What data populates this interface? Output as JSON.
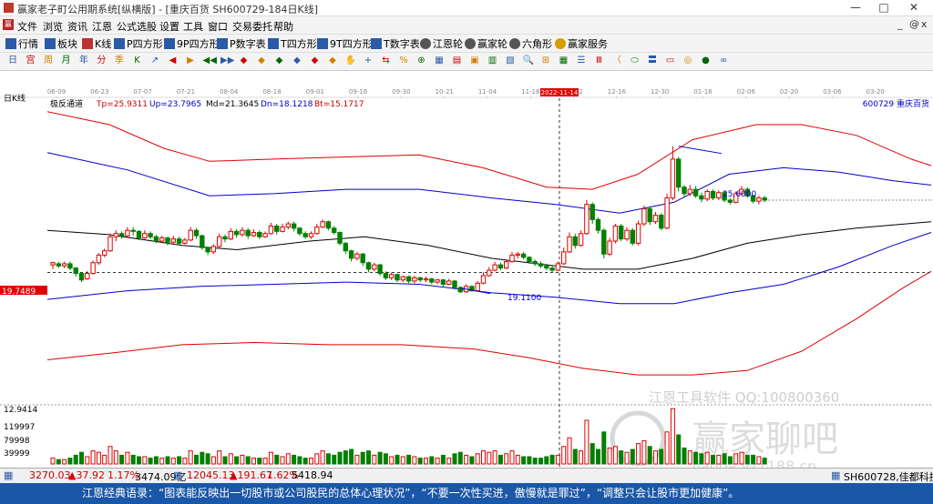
{
  "window": {
    "title": "赢家老子町公用期系统[纵横版] - [重庆百货  SH600729-184日K线]",
    "controls": [
      "—",
      "□",
      "✕"
    ]
  },
  "menu": {
    "items": [
      "文件",
      "浏览",
      "资讯",
      "江恩",
      "公式选股",
      "设置",
      "工具",
      "窗口",
      "交易委托",
      "帮助"
    ],
    "right_controls": [
      "_",
      "@",
      "x"
    ]
  },
  "toolbar1": {
    "buttons": [
      "行情",
      "板块",
      "K线",
      "P四方形",
      "9P四方形",
      "P数字表",
      "T四方形",
      "9T四方形",
      "T数字表",
      "江恩轮",
      "赢家轮",
      "六角形",
      "赢家服务"
    ]
  },
  "toolbar2": {
    "icons": [
      "日",
      "宫",
      "周",
      "月",
      "年",
      "分",
      "季",
      "K",
      "↗",
      "◀",
      "▶",
      "◀◀",
      "▶▶",
      "◆",
      "◆",
      "◆",
      "◆",
      "◆",
      "◆",
      "✋",
      "+",
      "⇆",
      "%",
      "⊕",
      "▦",
      "▤",
      "▣",
      "▥",
      "▧",
      "🔍",
      "⊞",
      "▦",
      "☰",
      "Ⅲ",
      "〈",
      "⬭",
      "〓",
      "▭",
      "◎",
      "●",
      "∞"
    ]
  },
  "chart_header": {
    "period_label": "日K线",
    "indicator": "极反通道",
    "tp": "Tp=25.9311",
    "up": "Up=23.7965",
    "md": "Md=21.3645",
    "dn": "Dn=18.1218",
    "bt": "Bt=15.1717",
    "stock": "600729  重庆百货"
  },
  "time_axis": {
    "labels": [
      "06-09",
      "06-23",
      "07-07",
      "07-21",
      "08-04",
      "08-18",
      "09-01",
      "09-16",
      "09-30",
      "10-21",
      "11-04",
      "11-18",
      "12-02",
      "12-16",
      "12-30",
      "01-16",
      "02-06",
      "02-20",
      "03-06",
      "03-20"
    ],
    "highlight": "2022-11-14"
  },
  "price_labels": {
    "current": "19.7489",
    "high_mark": "25.6000",
    "low_mark": "19.1100",
    "volume_top": "12.9414"
  },
  "volume_axis": {
    "labels": [
      "119997",
      "79998",
      "39999"
    ]
  },
  "watermarks": {
    "line1": "江恩工具软件  QQ:100800360",
    "line2": "赢家聊吧",
    "line3": "liaoba.yz1188.cn"
  },
  "statusbar": {
    "index1": "3270.03",
    "index1_chg": "▲37.92",
    "index1_pct": "1.17%",
    "index1_amt": "3474.09亿",
    "index2": "12045.13",
    "index2_chg": "▲191.67",
    "index2_pct": "1.62%",
    "index2_amt": "5418.94",
    "right": "SH600728,佳都科技"
  },
  "quote": "江恩经典语录：“图表能反映出一切股市或公司股民的总体心理状况”，“不要一次性买进，傲慢就是罪过”，“调整只会让股市更加健康”。",
  "chart_data": {
    "type": "candlestick",
    "y_min": 13.4,
    "y_max": 27.4,
    "markers": {
      "current_price": 19.7489,
      "peak": 25.6,
      "trough": 19.11
    },
    "channel_end_values": {
      "tp": 25.9311,
      "up": 23.7965,
      "md": 21.3645,
      "dn": 18.1218,
      "bt": 15.1717
    },
    "candles": [
      [
        20.1,
        20.2,
        19.9,
        20.25,
        4
      ],
      [
        20.15,
        20.05,
        19.95,
        20.25,
        3
      ],
      [
        20.05,
        20.15,
        19.95,
        20.25,
        3
      ],
      [
        20.15,
        19.95,
        19.85,
        20.25,
        4
      ],
      [
        19.95,
        19.7,
        19.55,
        20.0,
        6
      ],
      [
        19.7,
        19.4,
        19.3,
        19.75,
        8
      ],
      [
        19.45,
        19.7,
        19.4,
        19.8,
        5
      ],
      [
        19.7,
        20.2,
        19.65,
        20.3,
        9
      ],
      [
        20.2,
        20.55,
        20.1,
        20.65,
        8
      ],
      [
        20.55,
        20.75,
        20.45,
        20.85,
        6
      ],
      [
        20.75,
        21.4,
        20.7,
        21.55,
        12
      ],
      [
        21.4,
        21.55,
        21.2,
        21.7,
        9
      ],
      [
        21.55,
        21.45,
        21.3,
        21.65,
        6
      ],
      [
        21.45,
        21.7,
        21.4,
        21.85,
        8
      ],
      [
        21.7,
        21.65,
        21.45,
        21.85,
        6
      ],
      [
        21.65,
        21.35,
        21.25,
        21.7,
        5
      ],
      [
        21.35,
        21.55,
        21.3,
        21.7,
        5
      ],
      [
        21.55,
        21.4,
        21.3,
        21.65,
        4
      ],
      [
        21.4,
        21.2,
        21.1,
        21.5,
        5
      ],
      [
        21.2,
        21.35,
        21.1,
        21.45,
        4
      ],
      [
        21.35,
        21.15,
        21.0,
        21.4,
        5
      ],
      [
        21.15,
        21.3,
        21.05,
        21.45,
        4
      ],
      [
        21.3,
        21.1,
        21.0,
        21.4,
        5
      ],
      [
        21.1,
        21.25,
        21.05,
        21.35,
        4
      ],
      [
        21.25,
        21.7,
        21.2,
        21.85,
        9
      ],
      [
        21.7,
        21.45,
        21.3,
        21.8,
        6
      ],
      [
        21.45,
        20.9,
        20.8,
        21.5,
        8
      ],
      [
        20.9,
        20.7,
        20.55,
        20.95,
        7
      ],
      [
        20.7,
        20.95,
        20.6,
        21.05,
        5
      ],
      [
        20.95,
        21.4,
        20.9,
        21.55,
        9
      ],
      [
        21.4,
        21.3,
        21.15,
        21.5,
        5
      ],
      [
        21.3,
        21.65,
        21.25,
        21.8,
        7
      ],
      [
        21.65,
        21.5,
        21.35,
        21.75,
        5
      ],
      [
        21.5,
        21.7,
        21.4,
        21.85,
        6
      ],
      [
        21.7,
        21.45,
        21.3,
        21.8,
        5
      ],
      [
        21.45,
        21.6,
        21.4,
        21.75,
        4
      ],
      [
        21.6,
        21.4,
        21.3,
        21.7,
        4
      ],
      [
        21.4,
        21.55,
        21.35,
        21.65,
        4
      ],
      [
        21.55,
        21.9,
        21.5,
        22.05,
        8
      ],
      [
        21.9,
        21.65,
        21.5,
        22.0,
        6
      ],
      [
        21.65,
        21.85,
        21.6,
        22.0,
        5
      ],
      [
        21.85,
        22.0,
        21.75,
        22.1,
        7
      ],
      [
        22.0,
        21.8,
        21.65,
        22.1,
        6
      ],
      [
        21.8,
        21.55,
        21.45,
        21.85,
        5
      ],
      [
        21.55,
        21.4,
        21.3,
        21.65,
        4
      ],
      [
        21.4,
        21.55,
        21.3,
        21.65,
        4
      ],
      [
        21.55,
        21.85,
        21.5,
        22.0,
        7
      ],
      [
        21.85,
        22.1,
        21.8,
        22.2,
        9
      ],
      [
        22.1,
        21.8,
        21.7,
        22.15,
        7
      ],
      [
        21.8,
        21.6,
        21.5,
        21.9,
        6
      ],
      [
        21.6,
        21.1,
        21.0,
        21.65,
        8
      ],
      [
        21.1,
        20.75,
        20.6,
        21.15,
        9
      ],
      [
        20.75,
        20.4,
        20.25,
        20.8,
        10
      ],
      [
        20.4,
        20.6,
        20.3,
        20.7,
        6
      ],
      [
        20.6,
        20.2,
        20.05,
        20.65,
        8
      ],
      [
        20.2,
        19.9,
        19.75,
        20.25,
        9
      ],
      [
        19.9,
        20.1,
        19.8,
        20.2,
        6
      ],
      [
        20.1,
        19.7,
        19.6,
        20.15,
        8
      ],
      [
        19.7,
        19.5,
        19.4,
        19.8,
        7
      ],
      [
        19.5,
        19.65,
        19.4,
        19.75,
        5
      ],
      [
        19.65,
        19.4,
        19.3,
        19.7,
        6
      ],
      [
        19.4,
        19.55,
        19.3,
        19.6,
        5
      ],
      [
        19.55,
        19.35,
        19.25,
        19.6,
        6
      ],
      [
        19.35,
        19.5,
        19.25,
        19.6,
        5
      ],
      [
        19.5,
        19.4,
        19.3,
        19.55,
        4
      ],
      [
        19.4,
        19.45,
        19.3,
        19.55,
        4
      ],
      [
        19.45,
        19.3,
        19.2,
        19.5,
        5
      ],
      [
        19.3,
        19.4,
        19.2,
        19.45,
        4
      ],
      [
        19.4,
        19.2,
        19.1,
        19.45,
        6
      ],
      [
        19.2,
        19.35,
        19.15,
        19.45,
        4
      ],
      [
        19.35,
        19.05,
        18.95,
        19.4,
        7
      ],
      [
        19.05,
        18.85,
        18.8,
        19.1,
        8
      ],
      [
        18.85,
        19.1,
        18.8,
        19.2,
        6
      ],
      [
        19.1,
        18.9,
        18.85,
        19.15,
        5
      ],
      [
        18.9,
        19.25,
        18.85,
        19.35,
        7
      ],
      [
        19.25,
        19.6,
        19.2,
        19.75,
        9
      ],
      [
        19.6,
        19.85,
        19.55,
        20.0,
        8
      ],
      [
        19.85,
        20.1,
        19.8,
        20.25,
        9
      ],
      [
        20.1,
        19.95,
        19.85,
        20.2,
        6
      ],
      [
        19.95,
        20.25,
        19.9,
        20.35,
        7
      ],
      [
        20.25,
        20.55,
        20.2,
        20.7,
        9
      ],
      [
        20.55,
        20.6,
        20.4,
        20.7,
        6
      ],
      [
        20.6,
        20.45,
        20.35,
        20.7,
        5
      ],
      [
        20.45,
        20.25,
        20.15,
        20.5,
        5
      ],
      [
        20.25,
        20.15,
        20.05,
        20.35,
        4
      ],
      [
        20.15,
        20.05,
        19.95,
        20.25,
        4
      ],
      [
        20.05,
        19.95,
        19.85,
        20.15,
        5
      ],
      [
        19.95,
        19.85,
        19.75,
        20.05,
        6
      ],
      [
        19.85,
        20.15,
        19.8,
        20.25,
        6
      ],
      [
        20.15,
        20.7,
        20.1,
        20.9,
        12
      ],
      [
        20.7,
        21.4,
        20.65,
        21.6,
        18
      ],
      [
        21.4,
        21.0,
        20.85,
        21.55,
        10
      ],
      [
        21.0,
        21.55,
        20.95,
        21.7,
        9
      ],
      [
        21.55,
        22.9,
        21.5,
        23.1,
        30
      ],
      [
        22.9,
        22.2,
        22.0,
        23.0,
        14
      ],
      [
        22.2,
        21.7,
        21.55,
        22.3,
        10
      ],
      [
        21.7,
        20.6,
        20.4,
        21.8,
        22
      ],
      [
        20.6,
        21.2,
        20.5,
        21.35,
        11
      ],
      [
        21.2,
        21.9,
        21.1,
        22.0,
        12
      ],
      [
        21.9,
        21.3,
        21.2,
        22.0,
        9
      ],
      [
        21.3,
        21.7,
        21.2,
        21.85,
        8
      ],
      [
        21.7,
        21.1,
        21.0,
        21.8,
        10
      ],
      [
        21.1,
        22.0,
        21.0,
        22.15,
        14
      ],
      [
        22.0,
        22.7,
        21.9,
        22.85,
        16
      ],
      [
        22.7,
        22.1,
        21.95,
        22.8,
        12
      ],
      [
        22.1,
        22.4,
        22.0,
        22.55,
        9
      ],
      [
        22.4,
        21.8,
        21.7,
        22.5,
        10
      ],
      [
        21.8,
        23.2,
        21.75,
        23.4,
        22
      ],
      [
        23.2,
        25.0,
        23.1,
        25.6,
        38
      ],
      [
        25.0,
        23.7,
        23.5,
        25.1,
        20
      ],
      [
        23.7,
        23.4,
        23.2,
        23.8,
        11
      ],
      [
        23.4,
        23.6,
        23.3,
        23.8,
        9
      ],
      [
        23.6,
        23.3,
        23.2,
        23.75,
        8
      ],
      [
        23.3,
        23.15,
        23.0,
        23.45,
        7
      ],
      [
        23.15,
        23.5,
        23.05,
        23.6,
        8
      ],
      [
        23.5,
        23.2,
        23.1,
        23.6,
        6
      ],
      [
        23.2,
        23.45,
        23.1,
        23.55,
        6
      ],
      [
        23.45,
        23.1,
        23.0,
        23.55,
        7
      ],
      [
        23.1,
        23.0,
        22.9,
        23.2,
        5
      ],
      [
        23.0,
        23.4,
        22.95,
        23.5,
        7
      ],
      [
        23.4,
        23.6,
        23.3,
        23.75,
        8
      ],
      [
        23.6,
        23.3,
        23.2,
        23.7,
        6
      ],
      [
        23.3,
        23.05,
        22.95,
        23.35,
        6
      ],
      [
        23.05,
        23.2,
        22.9,
        23.3,
        5
      ],
      [
        23.2,
        23.1,
        23.0,
        23.3,
        4
      ]
    ]
  }
}
